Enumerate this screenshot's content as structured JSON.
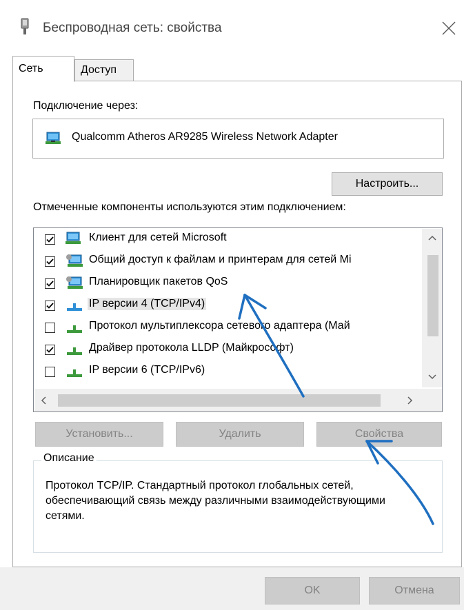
{
  "window": {
    "title": "Беспроводная сеть: свойства",
    "icon": "wireless-adapter-icon",
    "close_glyph": "✕"
  },
  "tabs": [
    {
      "label": "Сеть",
      "selected": true
    },
    {
      "label": "Доступ",
      "selected": false
    }
  ],
  "connect_via": {
    "label": "Подключение через:",
    "adapter_name": "Qualcomm Atheros AR9285 Wireless Network Adapter",
    "adapter_icon": "network-adapter-icon",
    "configure_label": "Настроить..."
  },
  "components": {
    "label": "Отмеченные компоненты используются этим подключением:",
    "items": [
      {
        "label": "Клиент для сетей Microsoft",
        "checked": true,
        "icon": "network-client-icon"
      },
      {
        "label": "Общий доступ к файлам и принтерам для сетей Mi",
        "checked": true,
        "icon": "network-service-icon"
      },
      {
        "label": "Планировщик пакетов QoS",
        "checked": true,
        "icon": "network-service-icon"
      },
      {
        "label": "IP версии 4 (TCP/IPv4)",
        "checked": true,
        "icon": "network-protocol-icon",
        "selected": true
      },
      {
        "label": "Протокол мультиплексора сетевого адаптера (Май",
        "checked": false,
        "icon": "network-protocol-icon"
      },
      {
        "label": "Драйвер протокола LLDP (Майкрософт)",
        "checked": true,
        "icon": "network-protocol-icon"
      },
      {
        "label": "IP версии 6 (TCP/IPv6)",
        "checked": false,
        "icon": "network-protocol-icon"
      }
    ]
  },
  "actions": {
    "install_label": "Установить...",
    "remove_label": "Удалить",
    "properties_label": "Свойства"
  },
  "description": {
    "title": "Описание",
    "text": "Протокол TCP/IP. Стандартный протокол глобальных сетей, обеспечивающий связь между различными взаимодействующими сетями."
  },
  "footer": {
    "ok_label": "OK",
    "cancel_label": "Отмена"
  },
  "colors": {
    "annotation_arrow": "#1f6fc0",
    "disabled_button": "#cccccc",
    "window_bg": "#ffffff"
  }
}
